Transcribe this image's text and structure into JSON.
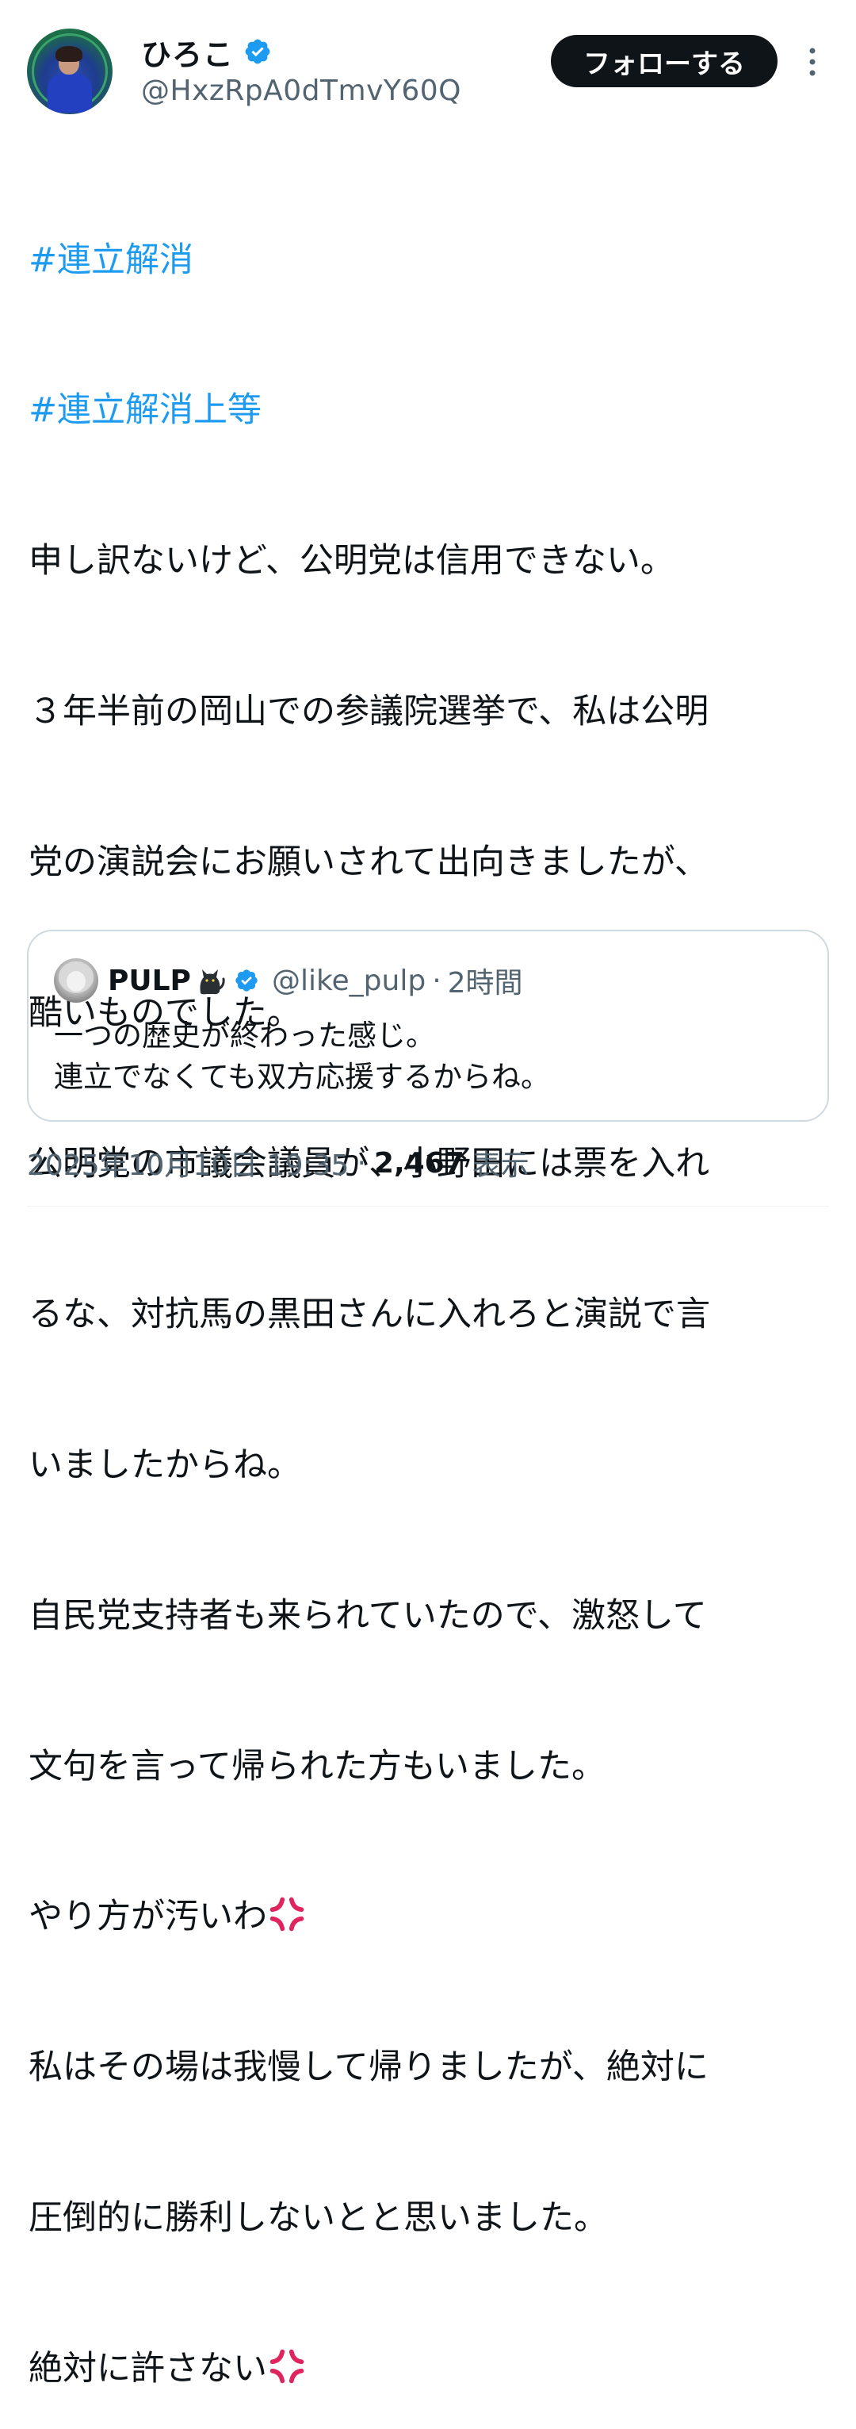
{
  "author": {
    "display_name": "ひろこ",
    "handle": "@HxzRpA0dTmvY60Q",
    "verified": true
  },
  "actions": {
    "follow_label": "フォローする",
    "more_icon": "more-dots-vertical-icon"
  },
  "post": {
    "hashtags": [
      "#連立解消",
      "#連立解消上等"
    ],
    "lines": [
      "申し訳ないけど、公明党は信用できない。",
      "３年半前の岡山での参議院選挙で、私は公明",
      "党の演説会にお願いされて出向きましたが、",
      "酷いものでした。",
      "公明党の市議会議員が、小野田には票を入れ",
      "るな、対抗馬の黒田さんに入れろと演説で言",
      "いましたからね。",
      "自民党支持者も来られていたので、激怒して",
      "文句を言って帰られた方もいました。",
      "やり方が汚いわ",
      "私はその場は我慢して帰りましたが、絶対に",
      "圧倒的に勝利しないとと思いました。",
      "絶対に許さない"
    ],
    "anger_emoji": "anger-symbol-icon"
  },
  "quote": {
    "display_name": "PULP",
    "name_emoji": "black-cat-icon",
    "verified": true,
    "handle": "@like_pulp",
    "separator": "·",
    "time": "2時間",
    "lines": [
      "一つの歴史が終わった感じ。",
      "連立でなくても双方応援するからね。"
    ]
  },
  "meta": {
    "date": "2025年10月10日 19:35",
    "separator": "·",
    "views_count": "2,467",
    "views_label": "表示"
  },
  "colors": {
    "accent": "#1d9bf0",
    "text": "#0f1419",
    "secondary": "#536471",
    "border": "#cfd9de",
    "anger": "#e0245e"
  }
}
